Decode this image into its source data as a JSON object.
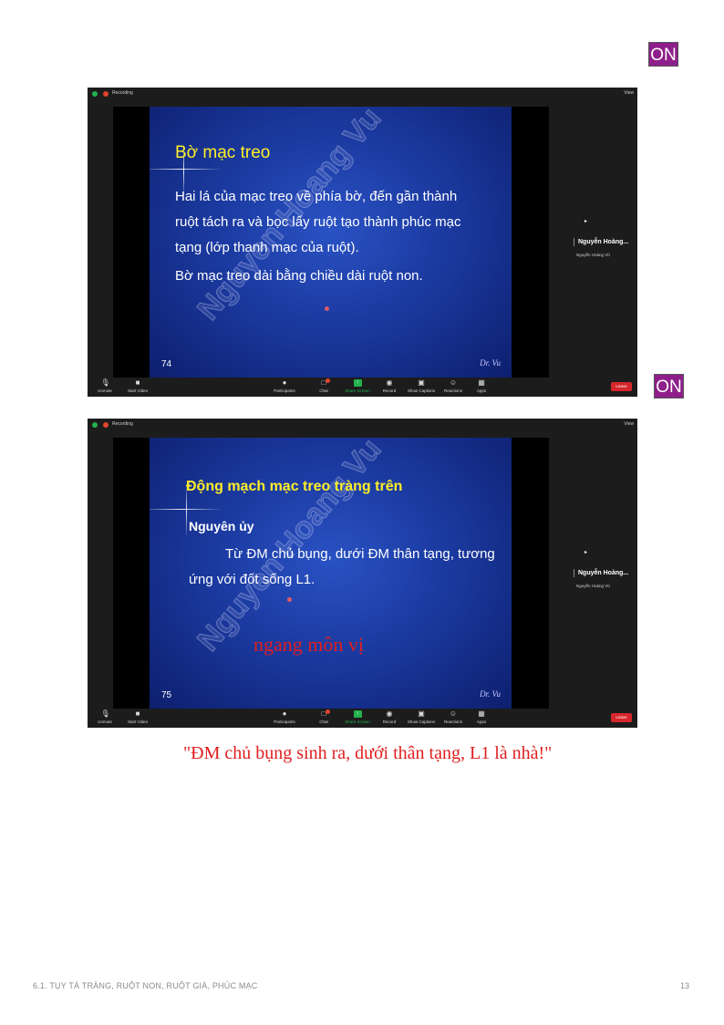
{
  "badges": {
    "on_top": "ON",
    "on_mid": "ON"
  },
  "zoom_common": {
    "recording_label": "Recording",
    "view_label": "View",
    "participant_name": "Nguyễn Hoàng...",
    "participant_sub": "Nguyễn Hoàng Vũ",
    "toolbar": {
      "unmute": "Unmute",
      "start_video": "Start Video",
      "participants": "Participants",
      "participants_count": "2/1",
      "chat": "Chat",
      "share_screen": "Share Screen",
      "record": "Record",
      "show_captions": "Show Captions",
      "reactions": "Reactions",
      "apps": "Apps",
      "leave": "Leave"
    }
  },
  "slide1": {
    "title": "Bờ mạc treo",
    "lines": [
      "Hai lá của mạc treo về phía bờ, đến gần thành",
      "ruột tách ra và bọc lấy ruột tạo thành phúc mạc",
      "tạng (lớp thanh mạc của ruột).",
      "Bờ mạc treo dài bằng chiều dài ruột non."
    ],
    "number": "74",
    "signature": "Dr. Vu",
    "watermark": "Nguyen Hoang Vu"
  },
  "slide2": {
    "title": "Động mạch mạc treo tràng trên",
    "subtitle": "Nguyên ủy",
    "lines": [
      "Từ ĐM chủ bụng, dưới ĐM thân tạng, tương",
      "ứng với đốt sống L1."
    ],
    "annotation": "ngang môn vị",
    "number": "75",
    "signature": "Dr. Vu",
    "watermark": "Nguyen Hoang Vu"
  },
  "note": "\"ĐM chủ bụng sinh ra, dưới thân tạng, L1 là nhà!\"",
  "footer": {
    "title": "6.1. TỤY TÁ TRÀNG, RUỘT NON, RUỘT GIÀ, PHÚC MẠC",
    "page": "13"
  },
  "colors": {
    "slide_title_1": "#ffee2a",
    "slide_title_2": "#ffee2a",
    "handwriting": "#e01e1e",
    "leave": "#d5262b",
    "share": "#22b14c",
    "badge": "#8e1f8a"
  }
}
